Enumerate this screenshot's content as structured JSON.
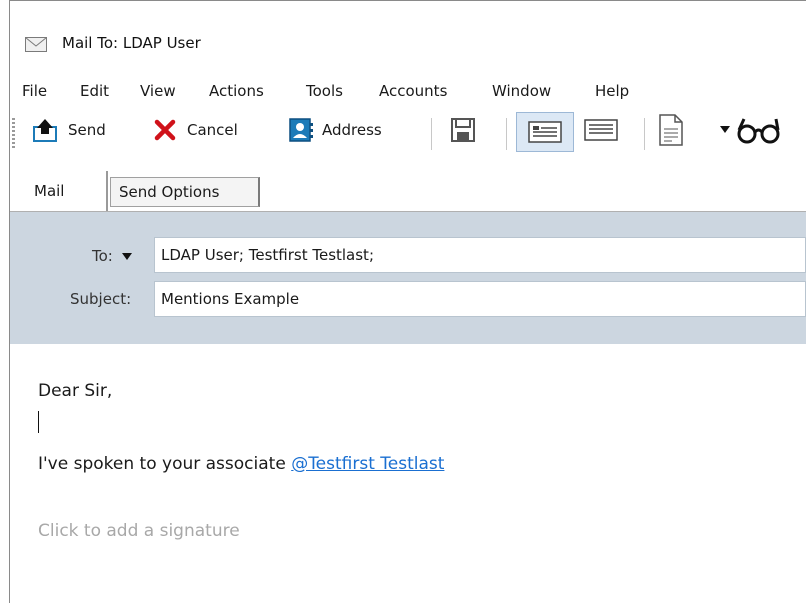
{
  "window": {
    "title": "Mail To: LDAP User"
  },
  "menu": {
    "items": [
      "File",
      "Edit",
      "View",
      "Actions",
      "Tools",
      "Accounts",
      "Window",
      "Help"
    ]
  },
  "toolbar": {
    "send_label": "Send",
    "cancel_label": "Cancel",
    "address_label": "Address"
  },
  "tabs": {
    "mail": "Mail",
    "send_options": "Send Options"
  },
  "header": {
    "to_label": "To:",
    "to_value": "LDAP User;  Testfirst Testlast;",
    "subject_label": "Subject:",
    "subject_value": "Mentions Example"
  },
  "body": {
    "greeting": "Dear Sir,",
    "text_before_mention": "I've spoken to your associate ",
    "mention": "@Testfirst Testlast",
    "signature_placeholder": "Click to add a signature"
  },
  "colors": {
    "header_bg": "#ccd6e0",
    "mention": "#1a6fd1",
    "cancel_x": "#d0121a",
    "send_arrow": "#1c7bb8"
  }
}
